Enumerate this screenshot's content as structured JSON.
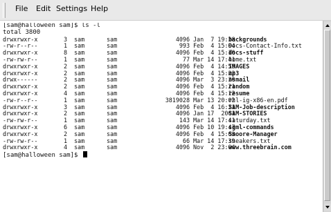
{
  "menubar": {
    "items": [
      {
        "label": "File"
      },
      {
        "label": "Edit"
      },
      {
        "label": "Settings"
      },
      {
        "label": "Help"
      }
    ]
  },
  "terminal": {
    "prompt_line": "[sam@halloween sam]$ ls -l",
    "total_line": "total 3800",
    "listing": [
      {
        "perm": "drwxrwxr-x",
        "links": "3",
        "owner": "sam",
        "group": "sam",
        "size": "4096",
        "date": "Jan  7 19:38",
        "name": "backgrounds",
        "bold": true
      },
      {
        "perm": "-rw-r--r--",
        "links": "1",
        "owner": "sam",
        "group": "sam",
        "size": "993",
        "date": "Feb  4 15:04",
        "name": "Docs-Contact-Info.txt",
        "bold": false
      },
      {
        "perm": "drwxrwxr-x",
        "links": "8",
        "owner": "sam",
        "group": "sam",
        "size": "4096",
        "date": "Feb  4 15:10",
        "name": "docs-stuff",
        "bold": true
      },
      {
        "perm": "-rw-rw-r--",
        "links": "1",
        "owner": "sam",
        "group": "sam",
        "size": "77",
        "date": "Mar 14 17:41",
        "name": "home.txt",
        "bold": false
      },
      {
        "perm": "drwxrwxr-x",
        "links": "2",
        "owner": "sam",
        "group": "sam",
        "size": "4096",
        "date": "Feb  4 14:59",
        "name": "IMAGES",
        "bold": true
      },
      {
        "perm": "drwxrwxr-x",
        "links": "2",
        "owner": "sam",
        "group": "sam",
        "size": "4096",
        "date": "Feb  4 15:22",
        "name": "mp3",
        "bold": true
      },
      {
        "perm": "drwx------",
        "links": "2",
        "owner": "sam",
        "group": "sam",
        "size": "4096",
        "date": "Mar  3 23:30",
        "name": "nsmail",
        "bold": true
      },
      {
        "perm": "drwxrwxr-x",
        "links": "2",
        "owner": "sam",
        "group": "sam",
        "size": "4096",
        "date": "Feb  4 15:21",
        "name": "random",
        "bold": true
      },
      {
        "perm": "drwxrwxr-x",
        "links": "4",
        "owner": "sam",
        "group": "sam",
        "size": "4096",
        "date": "Feb  4 15:12",
        "name": "resume",
        "bold": true
      },
      {
        "perm": "-rw-r--r--",
        "links": "1",
        "owner": "sam",
        "group": "sam",
        "size": "3819028",
        "date": "Mar 13 20:02",
        "name": "rhl-ig-x86-en.pdf",
        "bold": false
      },
      {
        "perm": "drwxrwxr-x",
        "links": "3",
        "owner": "sam",
        "group": "sam",
        "size": "4096",
        "date": "Feb  4 16:21",
        "name": "SAM-Job-description",
        "bold": true
      },
      {
        "perm": "drwxrwxr-x",
        "links": "2",
        "owner": "sam",
        "group": "sam",
        "size": "4096",
        "date": "Jan 17  2001",
        "name": "SAM-STORIES",
        "bold": true
      },
      {
        "perm": "-rw-rw-r--",
        "links": "1",
        "owner": "sam",
        "group": "sam",
        "size": "143",
        "date": "Mar 14 17:41",
        "name": "saturday.txt",
        "bold": false
      },
      {
        "perm": "drwxrwxr-x",
        "links": "6",
        "owner": "sam",
        "group": "sam",
        "size": "4096",
        "date": "Feb 10 19:47",
        "name": "sgml-commands",
        "bold": true
      },
      {
        "perm": "drwxrwxr-x",
        "links": "2",
        "owner": "sam",
        "group": "sam",
        "size": "4096",
        "date": "Feb  4 15:03",
        "name": "Smoore-Manager",
        "bold": true
      },
      {
        "perm": "-rw-rw-r--",
        "links": "1",
        "owner": "sam",
        "group": "sam",
        "size": "66",
        "date": "Mar 14 17:39",
        "name": "sneakers.txt",
        "bold": false
      },
      {
        "perm": "drwxrwxr-x",
        "links": "4",
        "owner": "sam",
        "group": "sam",
        "size": "4096",
        "date": "Nov  2 23:04",
        "name": "www.threebrain.com",
        "bold": true
      }
    ],
    "final_prompt": "[sam@halloween sam]$"
  },
  "colors": {
    "background": "#ffffff",
    "text": "#111111",
    "menubar": "#e9e9e9",
    "scrollbar": "#d6d6d6"
  },
  "icons": {
    "scroll_up": "arrow-up-icon",
    "scroll_down": "arrow-down-icon",
    "cursor": "block-cursor"
  }
}
